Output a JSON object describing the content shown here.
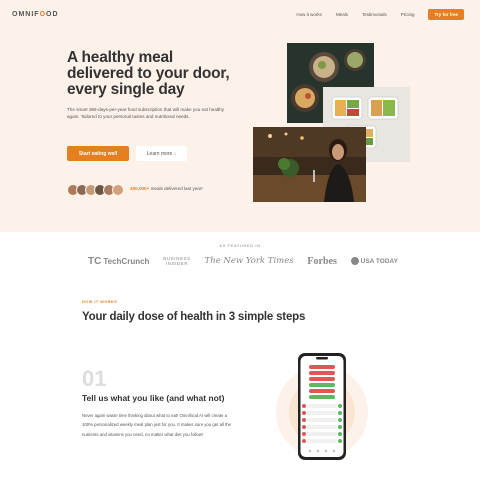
{
  "nav": {
    "logo_text": "OMNIF",
    "logo_accent": "O",
    "logo_rest": "OD",
    "links": [
      "How it works",
      "Meals",
      "Testimonials",
      "Pricing"
    ],
    "cta": "Try for free"
  },
  "hero": {
    "title": "A healthy meal delivered to your door, every single day",
    "description": "The smart 365-days-per-year food subscription that will make you eat healthy again. Tailored to your personal tastes and nutritional needs.",
    "primary_button": "Start eating well",
    "secondary_button": "Learn more ↓",
    "delivered_count": "250,000+",
    "delivered_text": " meals delivered last year!"
  },
  "featured": {
    "label": "AS FEATURED IN",
    "logos": {
      "techcrunch": "TechCrunch",
      "techcrunch_mark": "TC",
      "business_insider_line1": "BUSINESS",
      "business_insider_line2": "INSIDER",
      "nyt": "The New York Times",
      "forbes": "Forbes",
      "usatoday": "USA TODAY"
    }
  },
  "how": {
    "subheading": "HOW IT WORKS",
    "title": "Your daily dose of health in 3 simple steps",
    "step_number": "01",
    "step_title": "Tell us what you like (and what not)",
    "step_description": "Never again waste time thinking about what to eat! Omnifood AI will create a 100% personalized weekly meal plan just for you. It makes sure you get all the nutrients and vitamins you need, no matter what diet you follow!"
  },
  "colors": {
    "accent": "#e67e22",
    "hero_bg": "#fdf2e9"
  }
}
